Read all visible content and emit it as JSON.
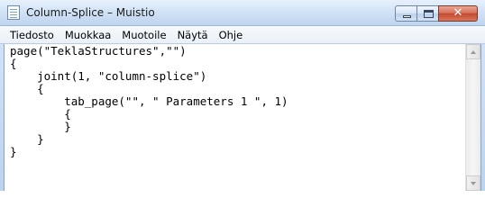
{
  "window": {
    "title": "Column-Splice – Muistio"
  },
  "menu": {
    "items": [
      "Tiedosto",
      "Muokkaa",
      "Muotoile",
      "Näytä",
      "Ohje"
    ]
  },
  "editor": {
    "lines": [
      "page(\"TeklaStructures\",\"\")",
      "{",
      "    joint(1, \"column-splice\")",
      "    {",
      "        tab_page(\"\", \" Parameters 1 \", 1)",
      "        {",
      "        }",
      "    }",
      "}"
    ]
  },
  "icons": {
    "app": "notepad-icon",
    "minimize": "minimize-icon",
    "maximize": "maximize-icon",
    "close": "close-icon",
    "scroll_up": "scroll-up-arrow-icon",
    "scroll_down": "scroll-down-arrow-icon"
  },
  "colors": {
    "titlebar": "#d2e3f6",
    "close_button": "#c44a2f",
    "editor_background": "#ffffff"
  }
}
